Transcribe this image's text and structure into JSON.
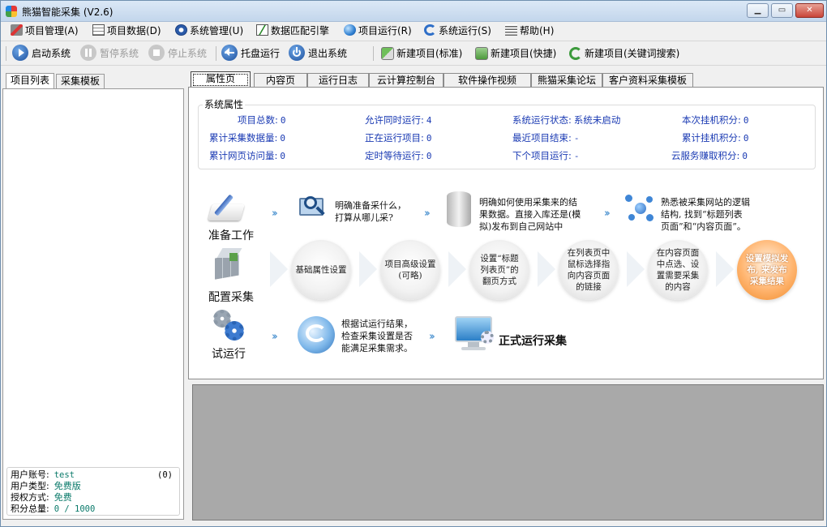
{
  "window": {
    "title": "熊猫智能采集  (V2.6)"
  },
  "menu": [
    {
      "label": "项目管理(A)",
      "icon": "project-icon"
    },
    {
      "label": "项目数据(D)",
      "icon": "table-icon"
    },
    {
      "label": "系统管理(U)",
      "icon": "gear-icon"
    },
    {
      "label": "数据匹配引擎",
      "icon": "chart-icon"
    },
    {
      "label": "项目运行(R)",
      "icon": "globe-icon"
    },
    {
      "label": "系统运行(S)",
      "icon": "sync-icon"
    },
    {
      "label": "帮助(H)",
      "icon": "list-icon"
    }
  ],
  "toolbar": {
    "start": "启动系统",
    "pause": "暂停系统",
    "stop": "停止系统",
    "tray": "托盘运行",
    "exit": "退出系统",
    "new_standard": "新建项目(标准)",
    "new_fast": "新建项目(快捷)",
    "new_keyword": "新建项目(关键词搜索)"
  },
  "left_tabs": [
    "项目列表",
    "采集模板"
  ],
  "user_info": {
    "account_label": "用户账号:",
    "account": "test",
    "count": "(0)",
    "type_label": "用户类型:",
    "type": "免费版",
    "auth_label": "授权方式:",
    "auth": "免费",
    "points_label": "积分总量:",
    "points": "0 / 1000"
  },
  "right_tabs": [
    "属性页",
    "内容页",
    "运行日志",
    "云计算控制台",
    "软件操作视频",
    "熊猫采集论坛",
    "客户资料采集模板"
  ],
  "sys": {
    "title": "系统属性",
    "stats": {
      "project_total": {
        "k": "项目总数:",
        "v": "0"
      },
      "cum_collect": {
        "k": "累计采集数据量:",
        "v": "0"
      },
      "cum_visits": {
        "k": "累计网页访问量:",
        "v": "0"
      },
      "allow_concurrent": {
        "k": "允许同时运行:",
        "v": "4"
      },
      "running": {
        "k": "正在运行项目:",
        "v": "0"
      },
      "scheduled": {
        "k": "定时等待运行:",
        "v": "0"
      },
      "sys_state": {
        "k": "系统运行状态:",
        "v": "系统未启动"
      },
      "recent_end": {
        "k": "最近项目结束:",
        "v": "-"
      },
      "next_project": {
        "k": "下个项目运行:",
        "v": "-"
      },
      "this_points": {
        "k": "本次挂机积分:",
        "v": "0"
      },
      "cum_points": {
        "k": "累计挂机积分:",
        "v": "0"
      },
      "cloud_points": {
        "k": "云服务赚取积分:",
        "v": "0"
      }
    }
  },
  "flow": {
    "row1_label": "准备工作",
    "row1_t1": "明确准备采什么，\n打算从哪儿采?",
    "row1_t2": "明确如何使用采集来的结\n果数据。直接入库还是(模\n拟)发布到自己网站中",
    "row1_t3": "熟悉被采集网站的逻辑\n结构, 找到“标题列表\n页面”和“内容页面”。",
    "row2_label": "配置采集",
    "c1": "基础属性设置",
    "c2": "项目高级设置\n(可略)",
    "c3": "设置“标题\n列表页”的\n翻页方式",
    "c4": "在列表页中\n鼠标选择指\n向内容页面\n的链接",
    "c5": "在内容页面\n中点选、设\n置需要采集\n的内容",
    "c6": "设置模拟发\n布, 来发布\n采集结果",
    "row3_label": "试运行",
    "row3_t1": "根据试运行结果，\n检查采集设置是否\n能满足采集需求。",
    "row3_t2": "正式运行采集"
  }
}
